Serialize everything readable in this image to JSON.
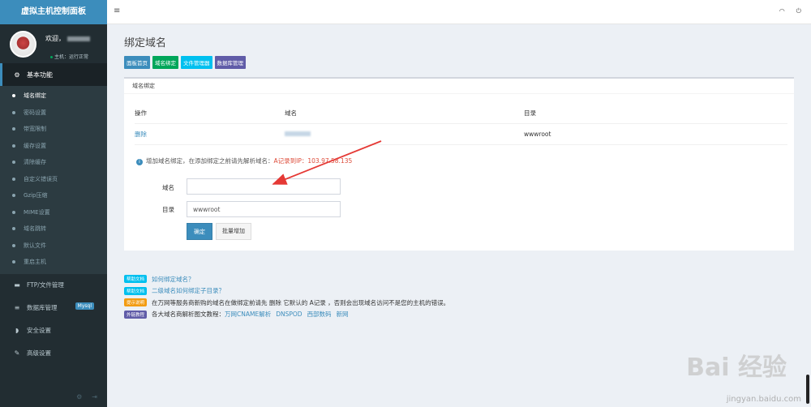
{
  "brand": "虚拟主机控制面板",
  "user": {
    "welcome": "欢迎，",
    "status": "主机：运行正常"
  },
  "sidebar": {
    "basic_header": "基本功能",
    "sub_items": [
      {
        "label": "域名绑定",
        "active": true
      },
      {
        "label": "密码设置"
      },
      {
        "label": "带宽限制"
      },
      {
        "label": "缓存设置"
      },
      {
        "label": "清除缓存"
      },
      {
        "label": "自定义错误页"
      },
      {
        "label": "Gzip压缩"
      },
      {
        "label": "MIME设置"
      },
      {
        "label": "域名跳转"
      },
      {
        "label": "默认文件"
      },
      {
        "label": "重启主机"
      }
    ],
    "items": [
      {
        "label": "FTP/文件管理",
        "icon": "folder-icon"
      },
      {
        "label": "数据库管理",
        "icon": "database-icon",
        "badge": "Mysql"
      },
      {
        "label": "安全设置",
        "icon": "shield-icon"
      },
      {
        "label": "高级设置",
        "icon": "edit-icon"
      }
    ]
  },
  "page_title": "绑定域名",
  "quick_links": [
    {
      "label": "面板首页",
      "color": "#3c8dbc"
    },
    {
      "label": "域名绑定",
      "color": "#00a65a"
    },
    {
      "label": "文件管理器",
      "color": "#00c0ef"
    },
    {
      "label": "数据库管理",
      "color": "#605ca8"
    }
  ],
  "panel": {
    "title": "域名绑定",
    "columns": [
      "操作",
      "域名",
      "目录"
    ],
    "rows": [
      {
        "action": "删除",
        "directory": "wwwroot"
      }
    ],
    "hint_prefix": "增加域名绑定，在添加绑定之前请先解析域名：",
    "hint_red": "A记录到IP：103.97.58.135",
    "form": {
      "domain_label": "域名",
      "domain_value": "",
      "dir_label": "目录",
      "dir_value": "wwwroot",
      "confirm_button": "确定",
      "batch_button": "批量增加"
    }
  },
  "docs": [
    {
      "tag": "帮助文档",
      "link": "如何绑定域名？"
    },
    {
      "tag": "帮助文档",
      "link": "二级域名如何绑定子目录？"
    },
    {
      "tag": "提示说明",
      "text": "在万网等服务商新购的域名在做绑定前请先 删除 它默认的 A记录 ，否则会出现域名访问不是您的主机的错误。"
    },
    {
      "tag": "外链教程",
      "text": "各大域名商解析图文教程：",
      "links": [
        "万网CNAME解析",
        "DNSPOD",
        "西部数码",
        "新网"
      ]
    }
  ],
  "watermark": {
    "brand": "Bai 经验",
    "url": "jingyan.baidu.com"
  }
}
